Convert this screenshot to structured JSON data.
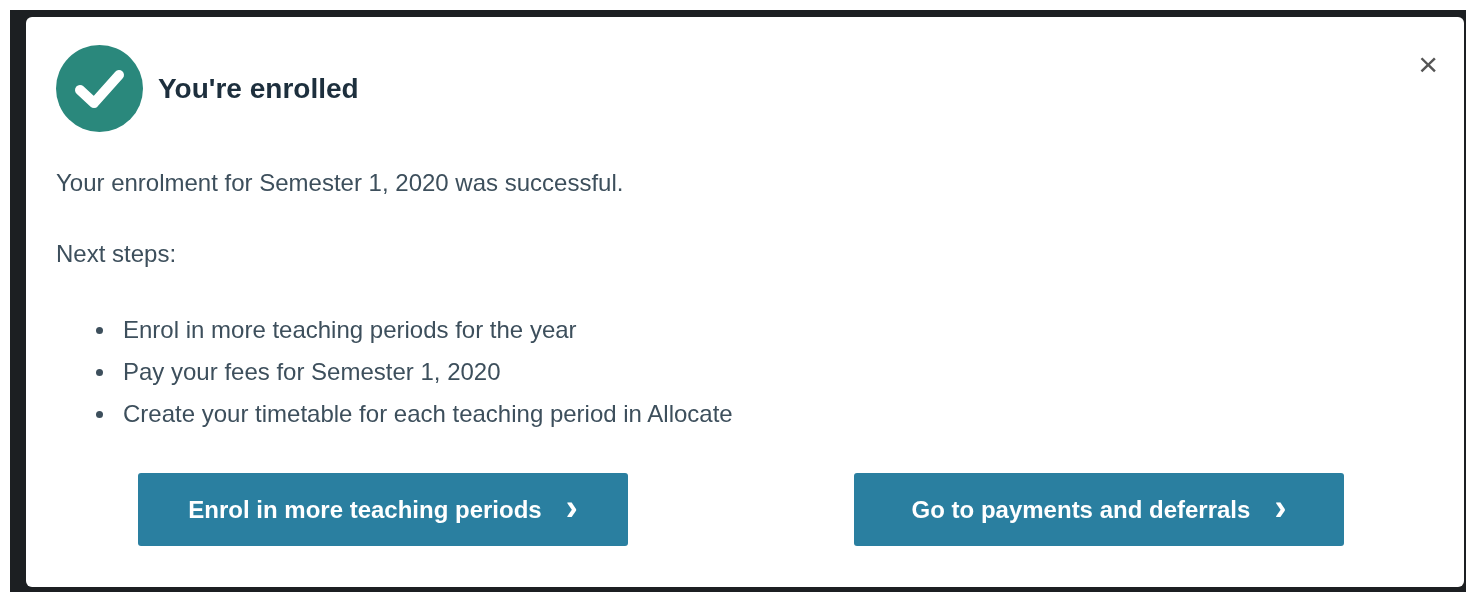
{
  "dialog": {
    "title": "You're enrolled",
    "close": "×",
    "message": "Your enrolment for Semester 1, 2020 was successful.",
    "next_steps_label": "Next steps:",
    "steps": [
      "Enrol in more teaching periods for the year",
      "Pay your fees for Semester 1, 2020",
      "Create your timetable for each teaching period in Allocate"
    ],
    "buttons": [
      {
        "label": "Enrol in more teaching periods",
        "icon": "›"
      },
      {
        "label": "Go to payments and deferrals",
        "icon": "›"
      }
    ]
  }
}
